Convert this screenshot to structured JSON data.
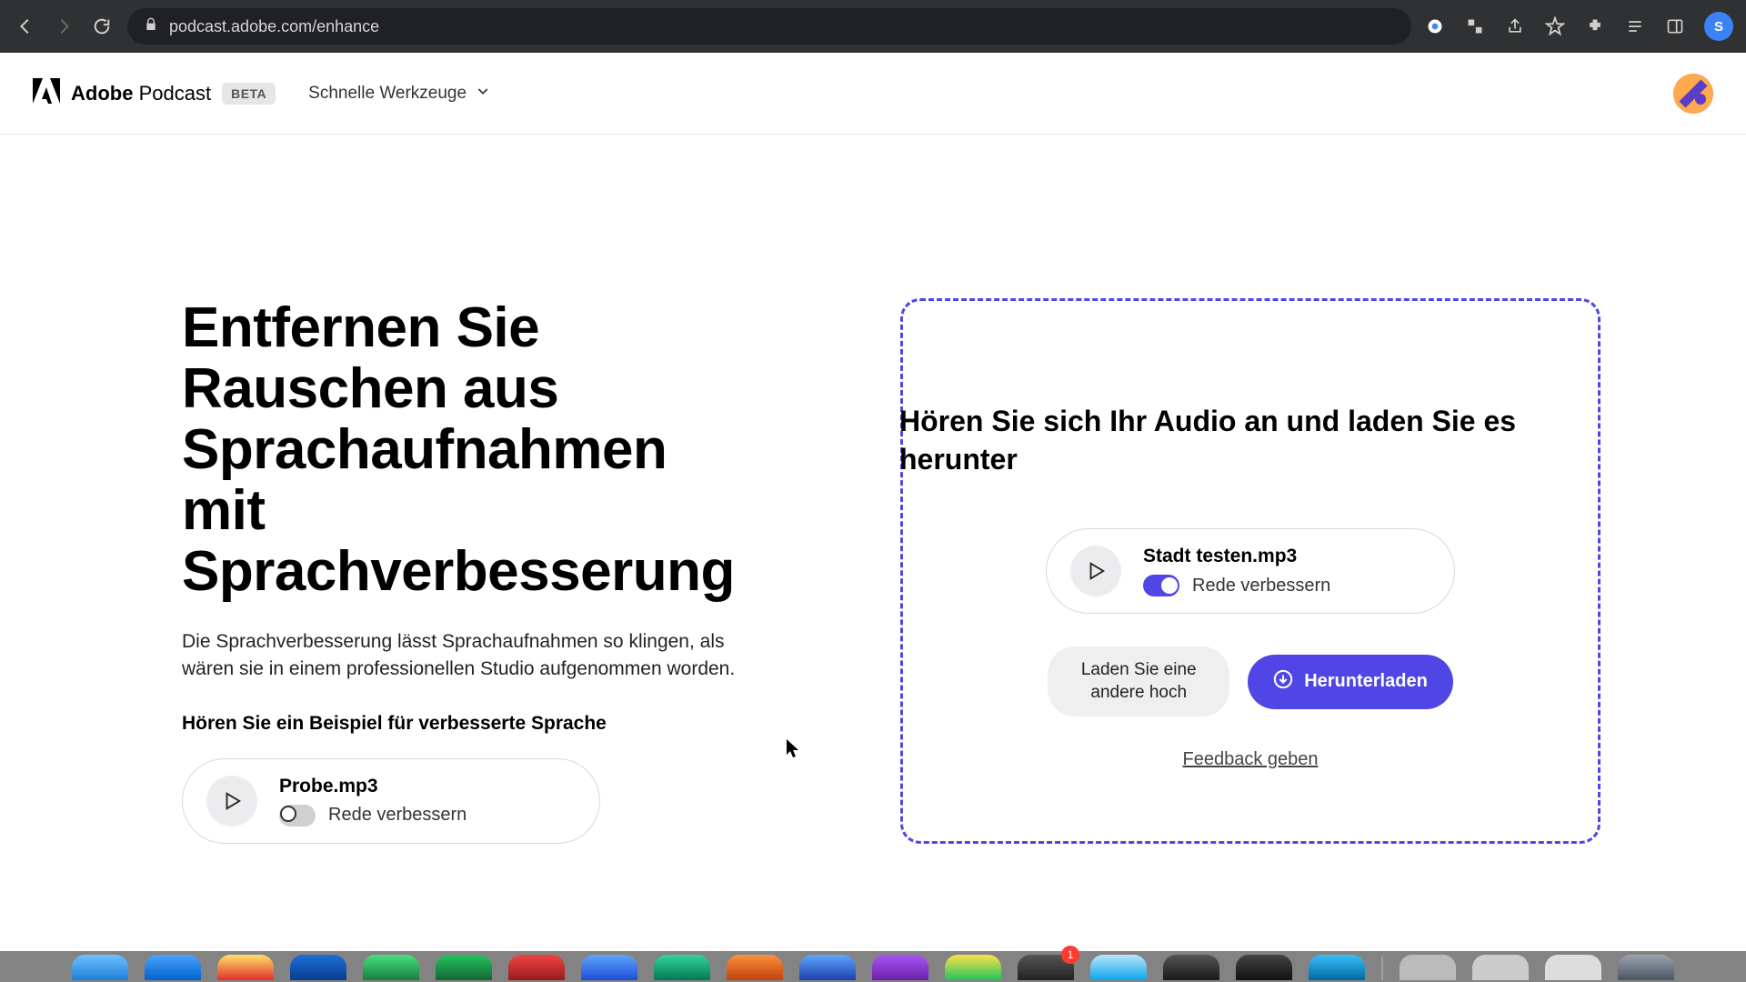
{
  "browser": {
    "url": "podcast.adobe.com/enhance",
    "avatar_initial": "S"
  },
  "header": {
    "brand_a": "Adobe",
    "brand_b": "Podcast",
    "beta": "BETA",
    "menu": "Schnelle Werkzeuge"
  },
  "hero": {
    "title": "Entfernen Sie Rauschen aus Sprachaufnahmen mit Sprachverbesserung",
    "desc": "Die Sprachverbesserung lässt Sprachaufnahmen so klingen, als wären sie in einem professionellen Studio aufgenommen worden.",
    "sample_heading": "Hören Sie ein Beispiel für verbesserte Sprache",
    "sample": {
      "filename": "Probe.mp3",
      "toggle_label": "Rede verbessern",
      "toggle_on": false
    }
  },
  "drop": {
    "title": "Hören Sie sich Ihr Audio an und laden Sie es herunter",
    "file": {
      "filename": "Stadt testen.mp3",
      "toggle_label": "Rede verbessern",
      "toggle_on": true
    },
    "upload_another": "Laden Sie eine andere hoch",
    "download": "Herunterladen",
    "feedback": "Feedback geben"
  },
  "dock": {
    "badge": "1"
  }
}
